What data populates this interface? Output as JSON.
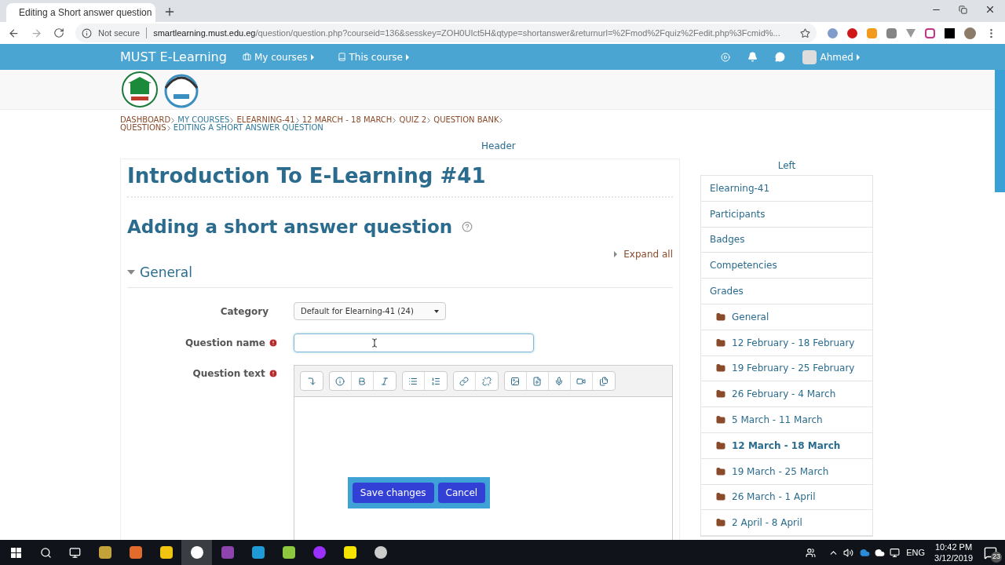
{
  "browser": {
    "tab_title": "Editing a Short answer question",
    "security": "Not secure",
    "url_host": "smartlearning.must.edu.eg",
    "url_path": "/question/question.php?courseid=136&sesskey=ZOH0UIct5H&qtype=shortanswer&returnurl=%2Fmod%2Fquiz%2Fedit.php%3Fcmid%..."
  },
  "navbar": {
    "brand": "MUST E-Learning",
    "menus": [
      "My courses",
      "This course"
    ],
    "user": "Ahmed"
  },
  "breadcrumb": [
    {
      "label": "DASHBOARD",
      "color": "#8a4b2a"
    },
    {
      "label": "MY COURSES",
      "color": "#2f7a9a"
    },
    {
      "label": "ELEARNING-41",
      "color": "#8a4b2a"
    },
    {
      "label": "12 MARCH - 18 MARCH",
      "color": "#8a4b2a"
    },
    {
      "label": "QUIZ 2",
      "color": "#8a4b2a"
    },
    {
      "label": "QUESTION BANK",
      "color": "#8a4b2a"
    },
    {
      "label": "QUESTIONS",
      "color": "#8a4b2a"
    },
    {
      "label": "EDITING A SHORT ANSWER QUESTION",
      "color": "#2f7a9a"
    }
  ],
  "header_region": "Header",
  "course_title": "Introduction To E-Learning #41",
  "page_heading": "Adding a short answer question",
  "expand_all": "Expand all",
  "section": {
    "title": "General",
    "expanded": true
  },
  "form": {
    "category": {
      "label": "Category",
      "value": "Default for Elearning-41 (24)"
    },
    "question_name": {
      "label": "Question name",
      "required": true
    },
    "question_text": {
      "label": "Question text",
      "required": true
    }
  },
  "actions": [
    "Save changes",
    "Cancel"
  ],
  "left_region": "Left",
  "sidebar": [
    {
      "label": "Elearning-41",
      "kind": "link",
      "current": false
    },
    {
      "label": "Participants",
      "kind": "link",
      "current": false
    },
    {
      "label": "Badges",
      "kind": "link",
      "current": false
    },
    {
      "label": "Competencies",
      "kind": "link",
      "current": false
    },
    {
      "label": "Grades",
      "kind": "link",
      "current": false
    },
    {
      "label": "General",
      "kind": "section",
      "current": false
    },
    {
      "label": "12 February - 18 February",
      "kind": "section",
      "current": false
    },
    {
      "label": "19 February - 25 February",
      "kind": "section",
      "current": false
    },
    {
      "label": "26 February - 4 March",
      "kind": "section",
      "current": false
    },
    {
      "label": "5 March - 11 March",
      "kind": "section",
      "current": false
    },
    {
      "label": "12 March - 18 March",
      "kind": "section",
      "current": true
    },
    {
      "label": "19 March - 25 March",
      "kind": "section",
      "current": false
    },
    {
      "label": "26 March - 1 April",
      "kind": "section",
      "current": false
    },
    {
      "label": "2 April - 8 April",
      "kind": "section",
      "current": false
    }
  ],
  "taskbar": {
    "language": "ENG",
    "time": "10:42 PM",
    "date": "3/12/2019",
    "notifications": "23"
  }
}
